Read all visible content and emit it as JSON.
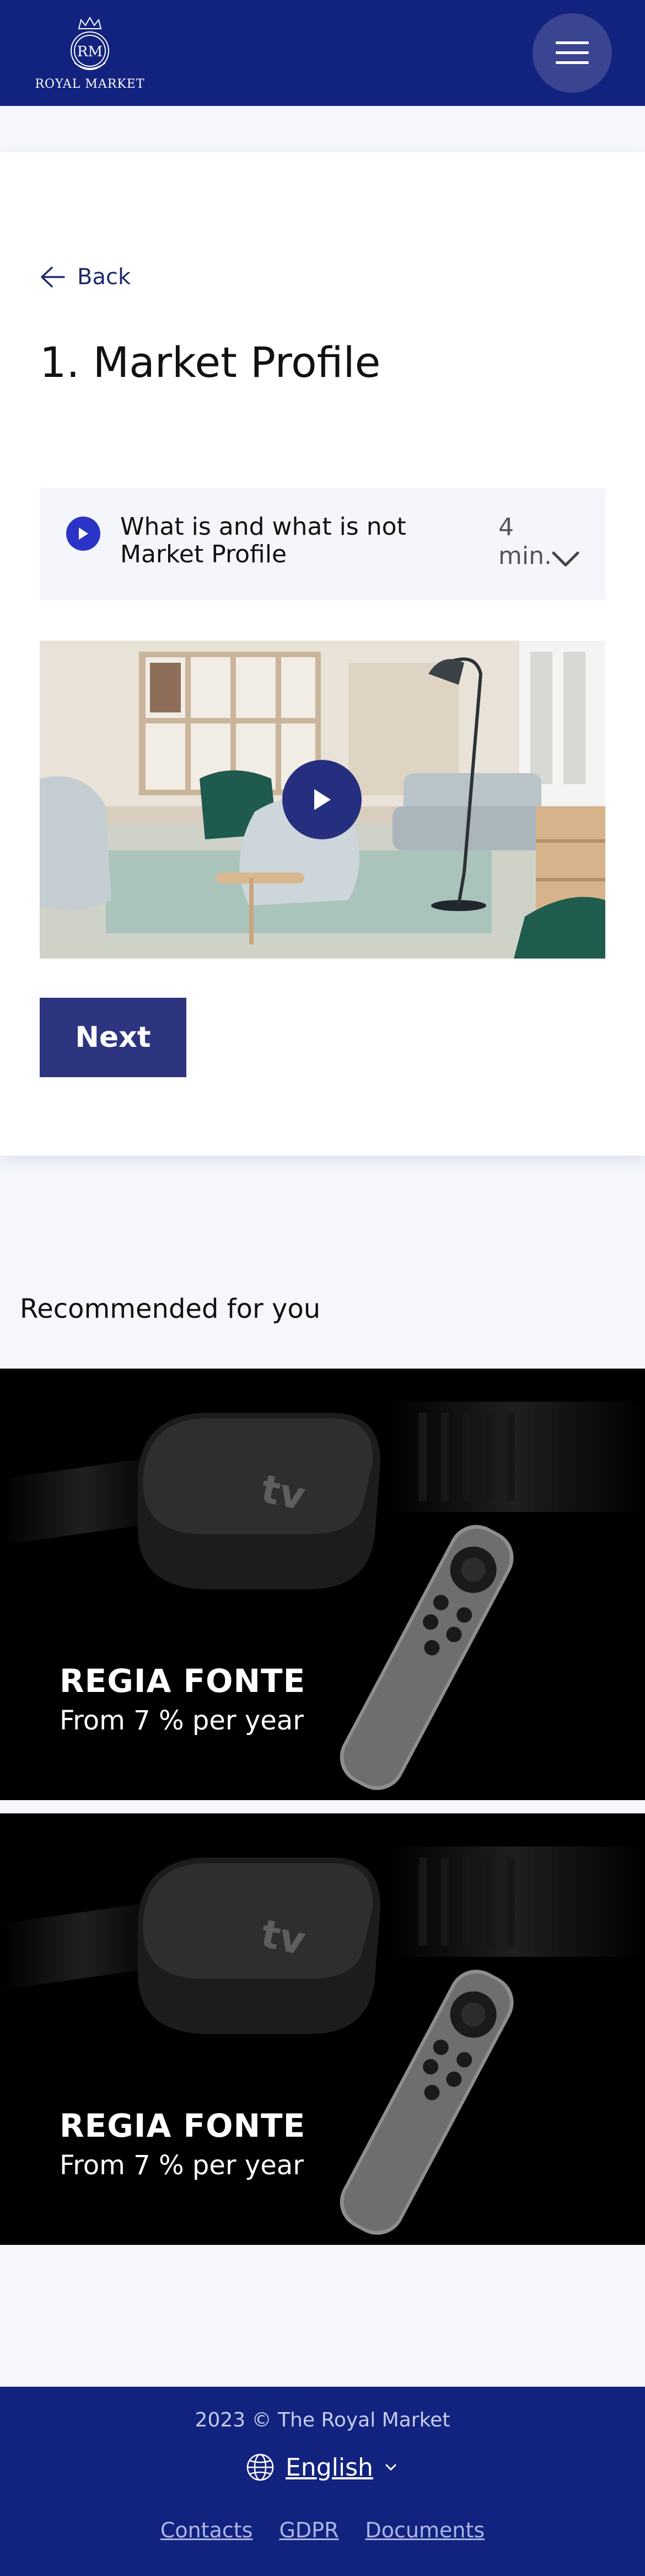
{
  "header": {
    "logo_monogram": "RM",
    "logo_text": "ROYAL MARKET",
    "menu_icon": "hamburger-menu-icon"
  },
  "lesson_page": {
    "back_label": "Back",
    "title": "1. Market Profile",
    "lesson_item": {
      "title": "What is and what is not Market Profile",
      "duration": "4 min.",
      "icon": "play-circle-icon"
    },
    "video": {
      "play_icon": "play-icon"
    },
    "next_label": "Next"
  },
  "recommended": {
    "title": "Recommended for you",
    "items": [
      {
        "name": "REGIA FONTE",
        "rate": "From 7 % per year",
        "image_text": "tv"
      },
      {
        "name": "REGIA FONTE",
        "rate": "From 7 % per year",
        "image_text": "tv"
      }
    ]
  },
  "footer": {
    "copyright": "2023 © The Royal Market",
    "language": "English",
    "links": [
      "Contacts",
      "GDPR",
      "Documents"
    ]
  },
  "colors": {
    "header_bg": "#12237f",
    "button_bg": "#2e3580",
    "play_accent": "#2a34c6",
    "page_bg": "#f5f7fd"
  }
}
